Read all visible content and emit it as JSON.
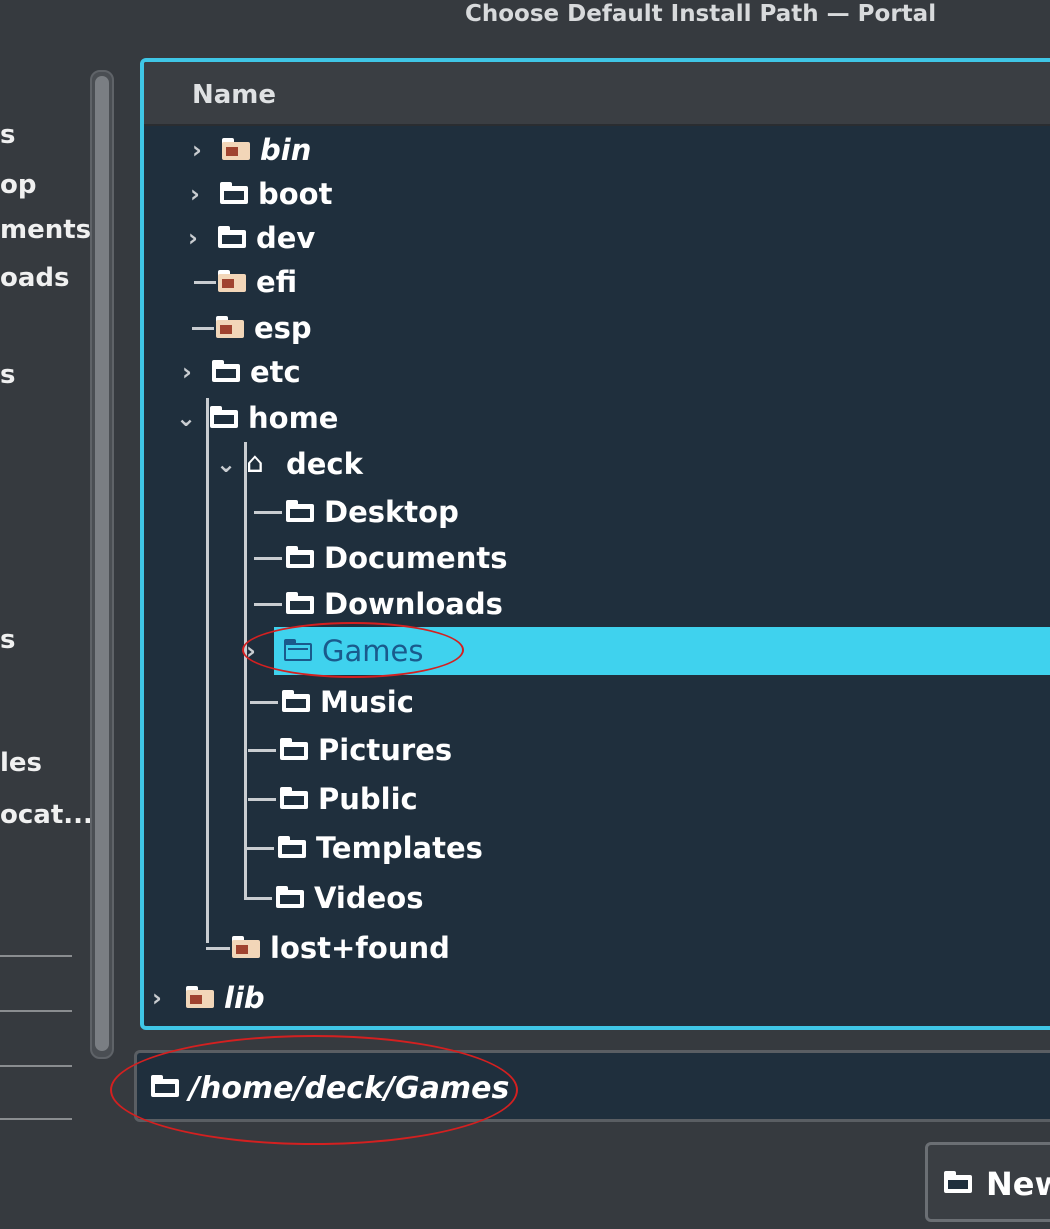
{
  "window": {
    "title": "Choose Default Install Path — Portal"
  },
  "places": {
    "items": [
      "s",
      "op",
      "ments",
      "oads",
      "s",
      "s",
      "les",
      "ocat..."
    ]
  },
  "tree": {
    "column_header": "Name",
    "rows": {
      "bin": "bin",
      "boot": "boot",
      "dev": "dev",
      "efi": "efi",
      "esp": "esp",
      "etc": "etc",
      "home": "home",
      "deck": "deck",
      "desktop": "Desktop",
      "documents": "Documents",
      "downloads": "Downloads",
      "games": "Games",
      "music": "Music",
      "pictures": "Pictures",
      "public": "Public",
      "templates": "Templates",
      "videos": "Videos",
      "lostfound": "lost+found",
      "lib": "lib"
    },
    "selected": "Games"
  },
  "path_field": {
    "value": "/home/deck/Games"
  },
  "buttons": {
    "new_folder": "New"
  },
  "colors": {
    "accent": "#3fc6e6",
    "selection": "#3fd2ee",
    "annotation": "#d42020",
    "background": "#363a3f",
    "tree_bg": "#1f2f3d"
  },
  "icons": [
    "folder-icon",
    "locked-folder-icon",
    "home-folder-icon",
    "expand-arrow-icon",
    "new-folder-icon"
  ]
}
